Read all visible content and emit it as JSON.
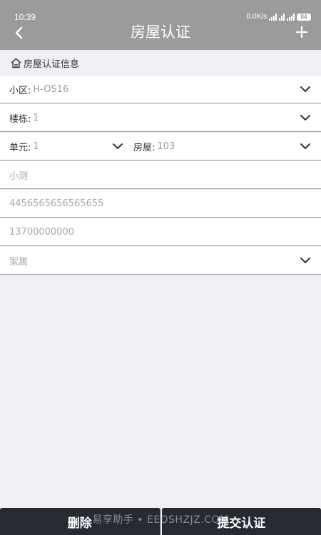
{
  "status_bar": {
    "time": "10:39",
    "net_speed": "0.0K/s",
    "battery": "84"
  },
  "header": {
    "title": "房屋认证",
    "back_icon": "chevron-left-icon",
    "add_icon": "plus-icon",
    "bg_color": "#9b9b9b"
  },
  "section": {
    "title": "房屋认证信息",
    "icon": "home-icon"
  },
  "form": {
    "community": {
      "label": "小区:",
      "value": "H-OS16"
    },
    "building": {
      "label": "楼栋:",
      "value": "1"
    },
    "unit": {
      "label": "单元:",
      "value": "1"
    },
    "room": {
      "label": "房屋:",
      "value": "103"
    },
    "name": {
      "value": "小测"
    },
    "id_number": {
      "value": "4456565656565655"
    },
    "phone": {
      "value": "13700000000"
    },
    "relation": {
      "value": "家属"
    }
  },
  "actions": {
    "delete_label": "删除",
    "submit_label": "提交认证",
    "button_color": "#252a33"
  },
  "watermark": "易享助手 • EEDSHZJZ.COM"
}
